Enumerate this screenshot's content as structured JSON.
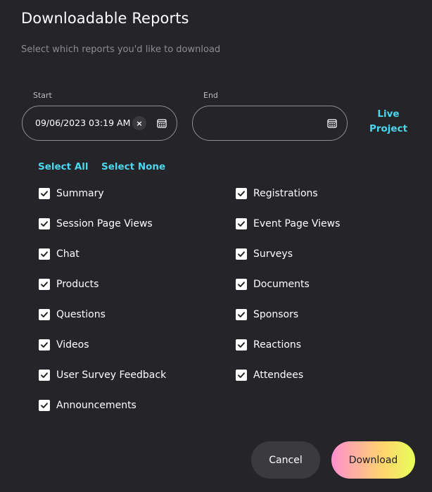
{
  "dialog": {
    "title": "Downloadable Reports",
    "subtitle": "Select which reports you'd like to download"
  },
  "start": {
    "label": "Start",
    "value": "09/06/2023 03:19 AM",
    "clear_glyph": "×"
  },
  "end": {
    "label": "End",
    "value": ""
  },
  "live_project": {
    "line1": "Live",
    "line2": "Project"
  },
  "selection": {
    "select_all": "Select All",
    "select_none": "Select None"
  },
  "reports_left": [
    {
      "label": "Summary",
      "checked": true
    },
    {
      "label": "Session Page Views",
      "checked": true
    },
    {
      "label": "Chat",
      "checked": true
    },
    {
      "label": "Products",
      "checked": true
    },
    {
      "label": "Questions",
      "checked": true
    },
    {
      "label": "Videos",
      "checked": true
    },
    {
      "label": "User Survey Feedback",
      "checked": true
    },
    {
      "label": "Announcements",
      "checked": true
    }
  ],
  "reports_right": [
    {
      "label": "Registrations",
      "checked": true
    },
    {
      "label": "Event Page Views",
      "checked": true
    },
    {
      "label": "Surveys",
      "checked": true
    },
    {
      "label": "Documents",
      "checked": true
    },
    {
      "label": "Sponsors",
      "checked": true
    },
    {
      "label": "Reactions",
      "checked": true
    },
    {
      "label": "Attendees",
      "checked": true
    }
  ],
  "actions": {
    "cancel": "Cancel",
    "download": "Download"
  },
  "colors": {
    "background": "#252428",
    "accent": "#4dd7ee",
    "field_border": "#8e8d94"
  }
}
